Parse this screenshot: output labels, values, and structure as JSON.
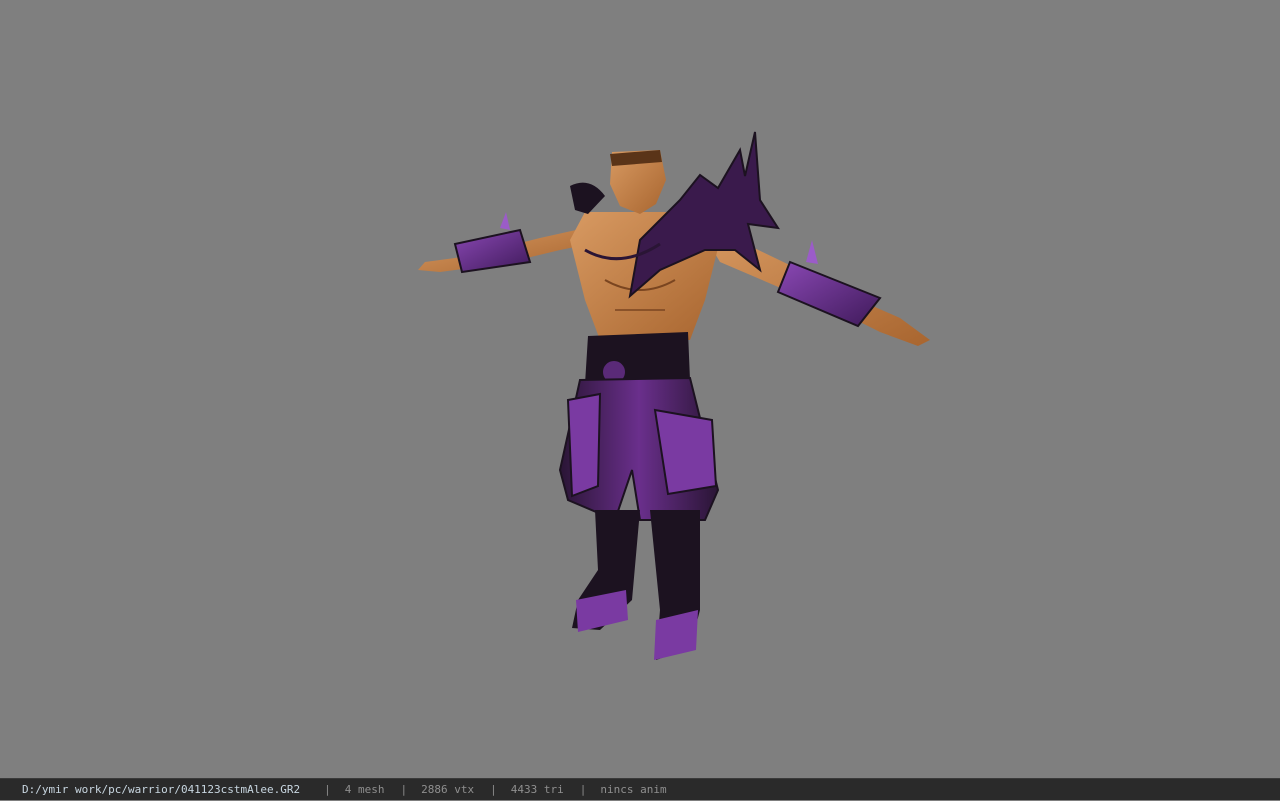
{
  "viewport": {
    "background": "#7f7f7f",
    "model": {
      "description_icon": "character-model",
      "skin_color": "#c8834f",
      "armor_color": "#6a2f8c",
      "armor_dark": "#1c1220"
    }
  },
  "statusbar": {
    "file_path": "D:/ymir work/pc/warrior/041123cstmAlee.GR2",
    "separator": "|",
    "mesh": "4 mesh",
    "vertices": "2886 vtx",
    "triangles": "4433 tri",
    "animation": "nincs anim"
  }
}
